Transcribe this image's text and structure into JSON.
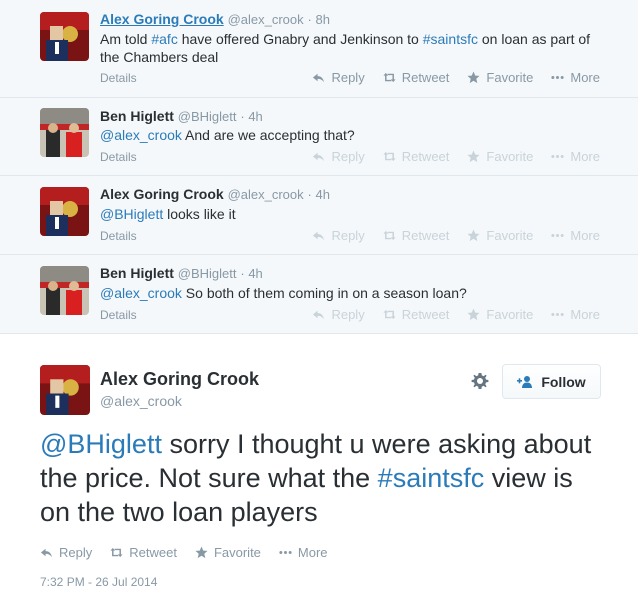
{
  "tweets": [
    {
      "name": "Alex Goring Crook",
      "handle": "@alex_crook",
      "time": "· 8h",
      "segments": [
        {
          "t": "Am told ",
          "link": false
        },
        {
          "t": "#afc",
          "link": true
        },
        {
          "t": " have offered Gnabry and Jenkinson to ",
          "link": false
        },
        {
          "t": "#saintsfc",
          "link": true
        },
        {
          "t": " on loan as part of the Chambers deal",
          "link": false
        }
      ],
      "details": "Details",
      "avatar": "arsenal-avatar"
    },
    {
      "name": "Ben Higlett",
      "handle": "@BHiglett",
      "time": "· 4h",
      "segments": [
        {
          "t": "@alex_crook",
          "link": true
        },
        {
          "t": " And are we accepting that?",
          "link": false
        }
      ],
      "details": "Details",
      "avatar": "stadium-avatar"
    },
    {
      "name": "Alex Goring Crook",
      "handle": "@alex_crook",
      "time": "· 4h",
      "segments": [
        {
          "t": "@BHiglett",
          "link": true
        },
        {
          "t": " looks like it",
          "link": false
        }
      ],
      "details": "Details",
      "avatar": "arsenal-avatar"
    },
    {
      "name": "Ben Higlett",
      "handle": "@BHiglett",
      "time": "· 4h",
      "segments": [
        {
          "t": "@alex_crook",
          "link": true
        },
        {
          "t": " So both of them coming in on a season loan?",
          "link": false
        }
      ],
      "details": "Details",
      "avatar": "stadium-avatar"
    }
  ],
  "actions": {
    "reply": "Reply",
    "retweet": "Retweet",
    "favorite": "Favorite",
    "more": "More"
  },
  "main": {
    "name": "Alex Goring Crook",
    "handle": "@alex_crook",
    "follow_label": "Follow",
    "segments": [
      {
        "t": "@BHiglett",
        "link": true
      },
      {
        "t": " sorry I thought u were asking about the price. Not sure what the ",
        "link": false
      },
      {
        "t": "#saintsfc",
        "link": true
      },
      {
        "t": " view is on the two loan players",
        "link": false
      }
    ],
    "timestamp": "7:32 PM - 26 Jul 2014"
  },
  "colors": {
    "link": "#2b7bb9",
    "muted": "#8899a6",
    "thread_bg": "#f5f8fa",
    "border": "#e1e8ed"
  }
}
